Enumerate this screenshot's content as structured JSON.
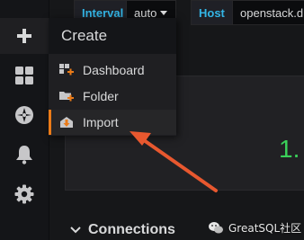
{
  "topbar": {
    "interval_label": "Interval",
    "interval_value": "auto",
    "host_label": "Host",
    "host_value": "openstack.d"
  },
  "sidebar": {
    "items": [
      {
        "icon": "plus-icon"
      },
      {
        "icon": "dashboards-grid-icon"
      },
      {
        "icon": "explore-compass-icon"
      },
      {
        "icon": "alerting-bell-icon"
      },
      {
        "icon": "configuration-gear-icon"
      }
    ]
  },
  "create_menu": {
    "title": "Create",
    "items": [
      {
        "label": "Dashboard",
        "icon": "dashboard-add-icon"
      },
      {
        "label": "Folder",
        "icon": "folder-add-icon"
      },
      {
        "label": "Import",
        "icon": "import-icon"
      }
    ]
  },
  "panel": {
    "stat_value": "1.",
    "stat_color": "#3ad059"
  },
  "row": {
    "title": "Connections"
  },
  "watermark": {
    "text": "GreatSQL社区"
  },
  "colors": {
    "accent_blue": "#33b5e5",
    "highlight_orange": "#eb7b18",
    "arrow_red": "#e8582f"
  }
}
